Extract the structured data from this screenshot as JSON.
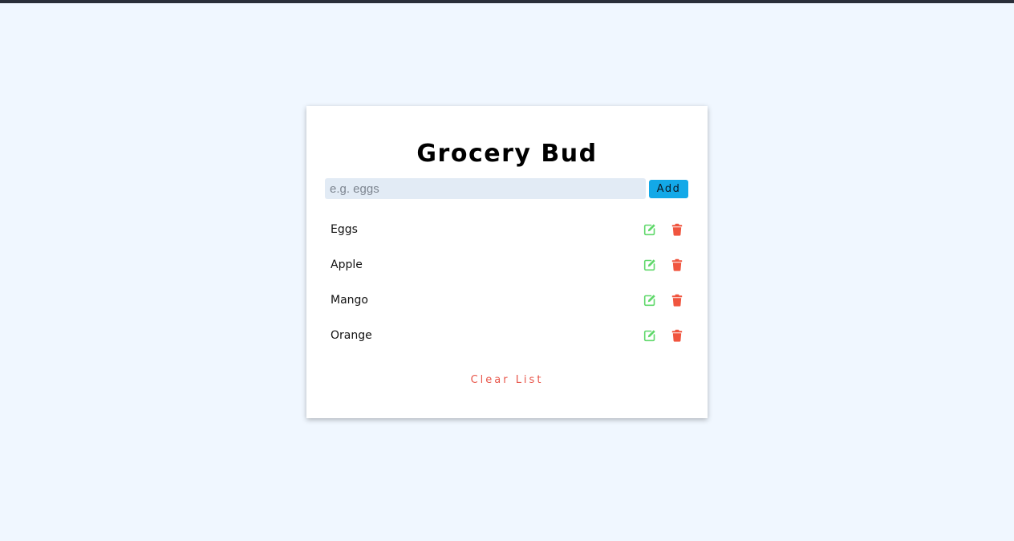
{
  "app": {
    "title": "Grocery Bud"
  },
  "form": {
    "placeholder": "e.g. eggs",
    "value": "",
    "add_label": "Add"
  },
  "items": [
    {
      "name": "Eggs"
    },
    {
      "name": "Apple"
    },
    {
      "name": "Mango"
    },
    {
      "name": "Orange"
    }
  ],
  "clear_label": "Clear List",
  "icons": {
    "edit": "edit-icon",
    "delete": "trash-icon"
  },
  "colors": {
    "background": "#f0f7ff",
    "card": "#ffffff",
    "accent": "#13a9e8",
    "edit": "#5fd86a",
    "delete": "#f0553f",
    "clear": "#e8564a"
  }
}
